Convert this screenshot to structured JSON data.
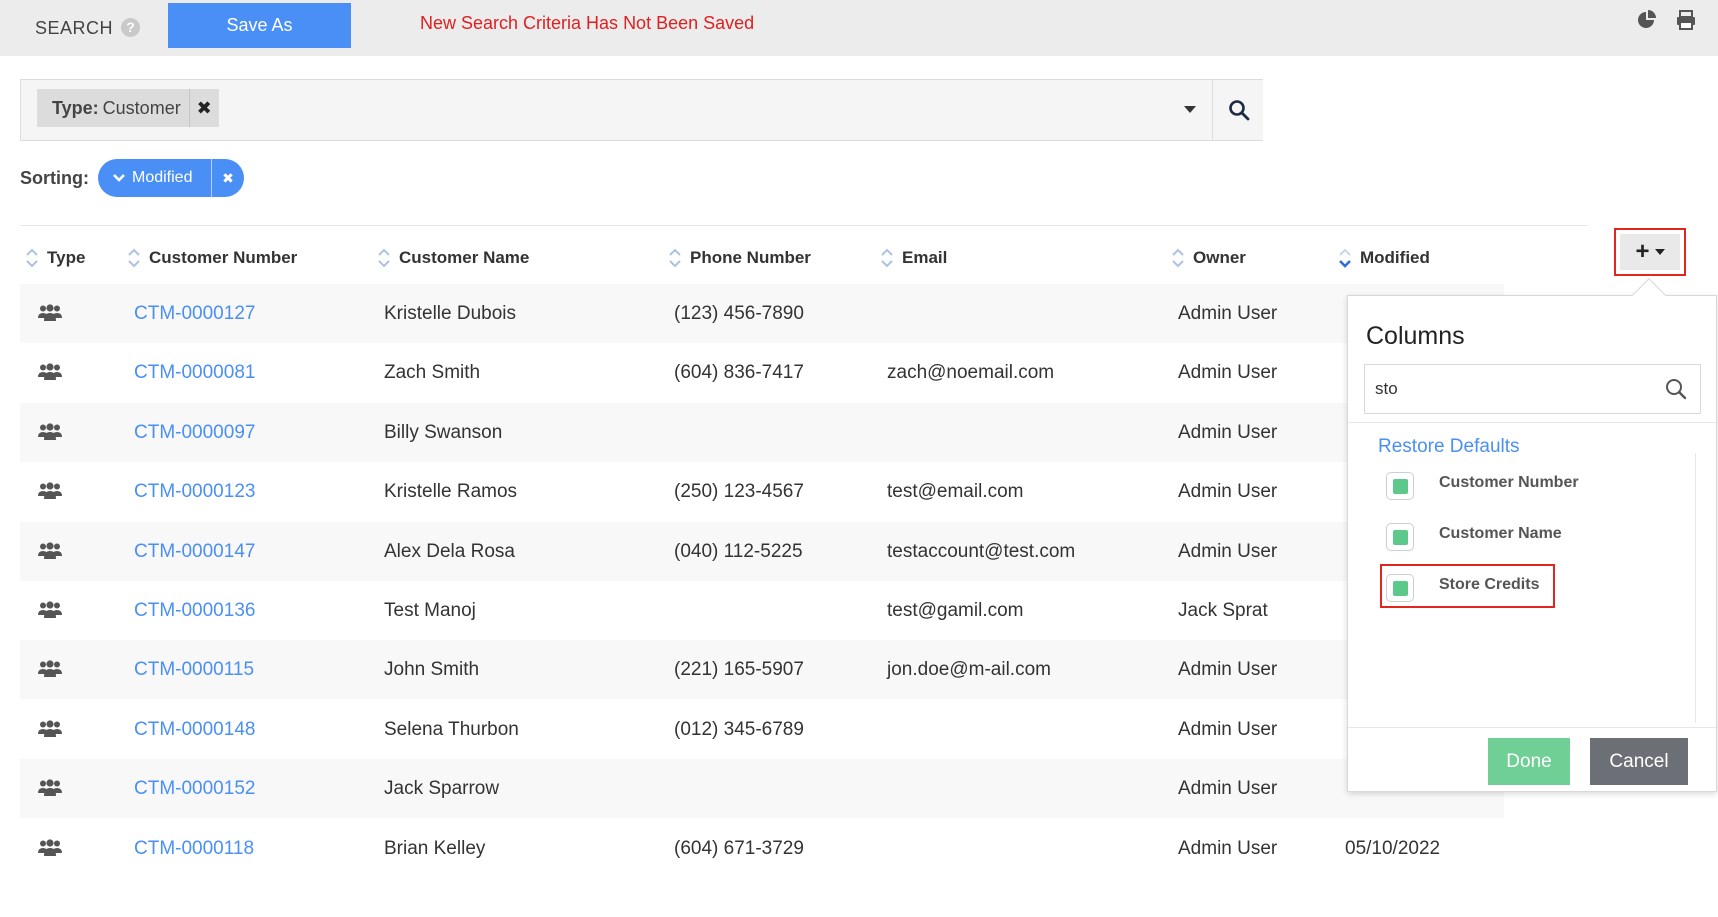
{
  "topbar": {
    "search_label": "SEARCH",
    "help_icon": "?",
    "save_as_label": "Save As",
    "unsaved_message": "New Search Criteria Has Not Been Saved"
  },
  "filter": {
    "tag_key": "Type:",
    "tag_value": "Customer",
    "tag_remove": "✖"
  },
  "sorting": {
    "label": "Sorting:",
    "pill_label": "Modified",
    "pill_remove": "✖"
  },
  "table": {
    "columns": [
      "Type",
      "Customer Number",
      "Customer Name",
      "Phone Number",
      "Email",
      "Owner",
      "Modified"
    ],
    "rows": [
      {
        "number": "CTM-0000127",
        "name": "Kristelle Dubois",
        "phone": "(123) 456-7890",
        "email": "",
        "owner": "Admin User",
        "modified": ""
      },
      {
        "number": "CTM-0000081",
        "name": "Zach Smith",
        "phone": "(604) 836-7417",
        "email": "zach@noemail.com",
        "owner": "Admin User",
        "modified": ""
      },
      {
        "number": "CTM-0000097",
        "name": "Billy Swanson",
        "phone": "",
        "email": "",
        "owner": "Admin User",
        "modified": ""
      },
      {
        "number": "CTM-0000123",
        "name": "Kristelle Ramos",
        "phone": "(250) 123-4567",
        "email": "test@email.com",
        "owner": "Admin User",
        "modified": ""
      },
      {
        "number": "CTM-0000147",
        "name": "Alex Dela Rosa",
        "phone": "(040) 112-5225",
        "email": "testaccount@test.com",
        "owner": "Admin User",
        "modified": ""
      },
      {
        "number": "CTM-0000136",
        "name": "Test Manoj",
        "phone": "",
        "email": "test@gamil.com",
        "owner": "Jack Sprat",
        "modified": ""
      },
      {
        "number": "CTM-0000115",
        "name": "John Smith",
        "phone": "(221) 165-5907",
        "email": "jon.doe@m-ail.com",
        "owner": "Admin User",
        "modified": ""
      },
      {
        "number": "CTM-0000148",
        "name": "Selena Thurbon",
        "phone": "(012) 345-6789",
        "email": "",
        "owner": "Admin User",
        "modified": ""
      },
      {
        "number": "CTM-0000152",
        "name": "Jack Sparrow",
        "phone": "",
        "email": "",
        "owner": "Admin User",
        "modified": ""
      },
      {
        "number": "CTM-0000118",
        "name": "Brian Kelley",
        "phone": "(604) 671-3729",
        "email": "",
        "owner": "Admin User",
        "modified": "05/10/2022"
      }
    ]
  },
  "columns_button": {
    "label": "+"
  },
  "columns_popup": {
    "title": "Columns",
    "search_value": "sto",
    "restore_defaults": "Restore Defaults",
    "items": [
      {
        "label": "Customer Number",
        "checked": true
      },
      {
        "label": "Customer Name",
        "checked": true
      },
      {
        "label": "Store Credits",
        "checked": true
      }
    ],
    "done_label": "Done",
    "cancel_label": "Cancel"
  },
  "colors": {
    "accent": "#4a8ff5",
    "alert": "#e02020",
    "highlight_border": "#e0261e",
    "check_fill": "#5cc98a",
    "done": "#6fcf94",
    "cancel": "#6d6f76"
  },
  "icons": {
    "type_icon": "users-icon",
    "pie": "pie-chart-icon",
    "print": "printer-icon",
    "search": "search-icon"
  }
}
